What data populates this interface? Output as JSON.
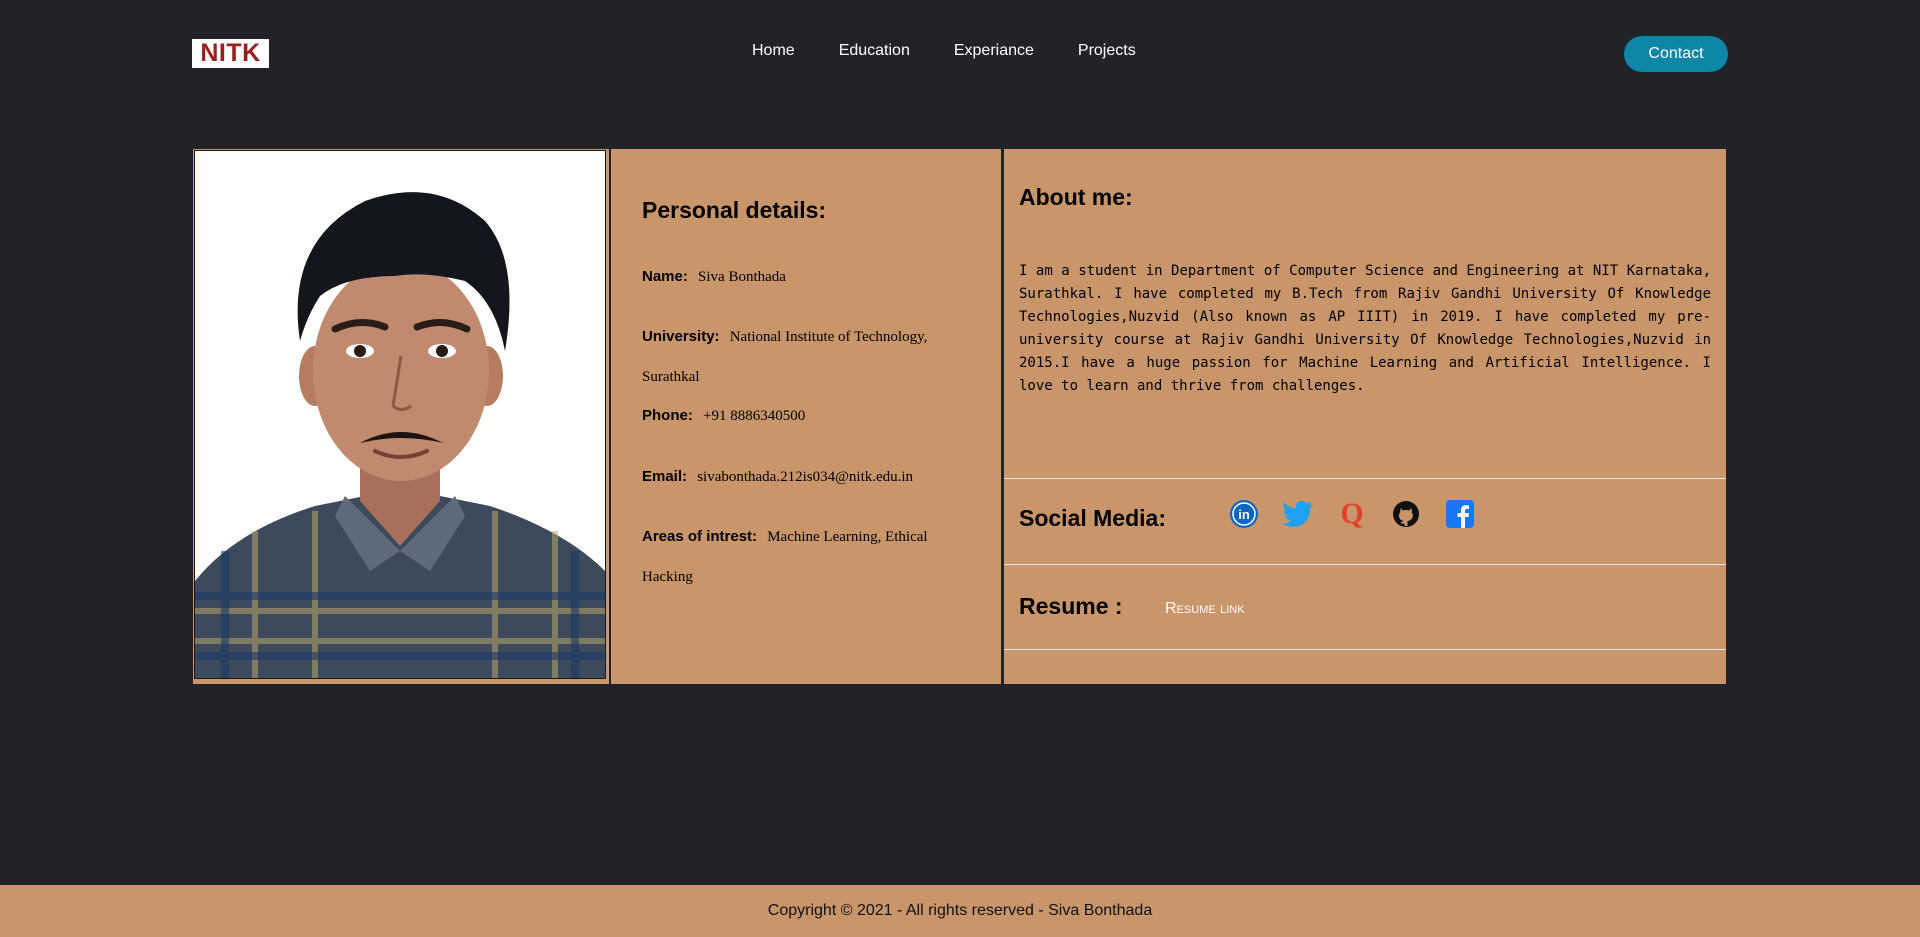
{
  "header": {
    "logo_text": "NITK",
    "nav": [
      "Home",
      "Education",
      "Experiance",
      "Projects"
    ],
    "contact_label": "Contact"
  },
  "personal": {
    "title": "Personal details:",
    "name_label": "Name:",
    "name_value": "Siva Bonthada",
    "university_label": "University:",
    "university_value": "National Institute of Technology, Surathkal",
    "phone_label": "Phone:",
    "phone_value": "+91 8886340500",
    "email_label": "Email:",
    "email_value": "sivabonthada.212is034@nitk.edu.in",
    "areas_label": "Areas of intrest:",
    "areas_value": "Machine Learning, Ethical Hacking"
  },
  "about": {
    "title": "About me:",
    "text": "I am a student in Department of Computer Science and Engineering at NIT Karnataka, Surathkal. I have completed my B.Tech from Rajiv Gandhi University Of Knowledge Technologies,Nuzvid (Also known as AP IIIT) in 2019. I have completed my pre-university course at Rajiv Gandhi University Of Knowledge Technologies,Nuzvid in 2015.I have a huge passion for Machine Learning and Artificial Intelligence. I love to learn and thrive from challenges."
  },
  "social": {
    "title": "Social Media:",
    "icons": [
      "linkedin-icon",
      "twitter-icon",
      "quora-icon",
      "github-icon",
      "facebook-icon"
    ]
  },
  "resume": {
    "title": "Resume :",
    "link_label": "Resume link"
  },
  "footer": {
    "text": "Copyright © 2021 - All rights reserved - Siva Bonthada"
  },
  "colors": {
    "background": "#222328",
    "panel": "#c9956a",
    "accent": "#0d86a8",
    "logo_red": "#9a1f1f"
  }
}
